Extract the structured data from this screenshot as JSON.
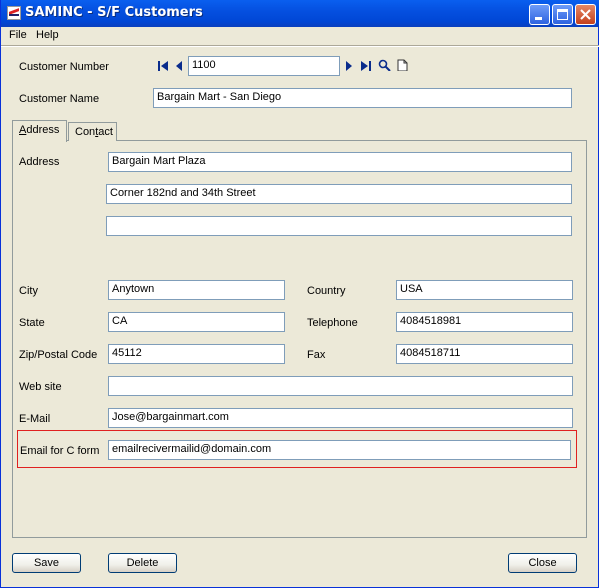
{
  "window": {
    "title": "SAMINC - S/F Customers"
  },
  "menu": [
    "File",
    "Help"
  ],
  "header": {
    "customer_number_label": "Customer Number",
    "customer_number_value": "1100",
    "customer_name_label": "Customer Name",
    "customer_name_value": "Bargain Mart - San Diego"
  },
  "tabs": [
    {
      "label_u": "A",
      "label_rest": "ddress",
      "active": true
    },
    {
      "label_pre": "Con",
      "label_u": "t",
      "label_rest": "act",
      "active": false
    }
  ],
  "address": {
    "label": "Address",
    "line1": "Bargain Mart Plaza",
    "line2": "Corner 182nd and 34th Street",
    "line3": ""
  },
  "fields": {
    "city_label": "City",
    "city": "Anytown",
    "country_label": "Country",
    "country": "USA",
    "state_label": "State",
    "state": "CA",
    "telephone_label": "Telephone",
    "telephone": "4084518981",
    "zip_label": "Zip/Postal Code",
    "zip": "45112",
    "fax_label": "Fax",
    "fax": "4084518711",
    "website_label": "Web site",
    "website": "",
    "email_label": "E-Mail",
    "email": "Jose@bargainmart.com",
    "cform_label": "Email for C form",
    "cform": "emailrecivermailid@domain.com"
  },
  "buttons": {
    "save": "Save",
    "delete": "Delete",
    "close": "Close"
  },
  "icons": [
    "first-record-icon",
    "previous-record-icon",
    "next-record-icon",
    "last-record-icon",
    "search-icon",
    "new-record-icon"
  ]
}
